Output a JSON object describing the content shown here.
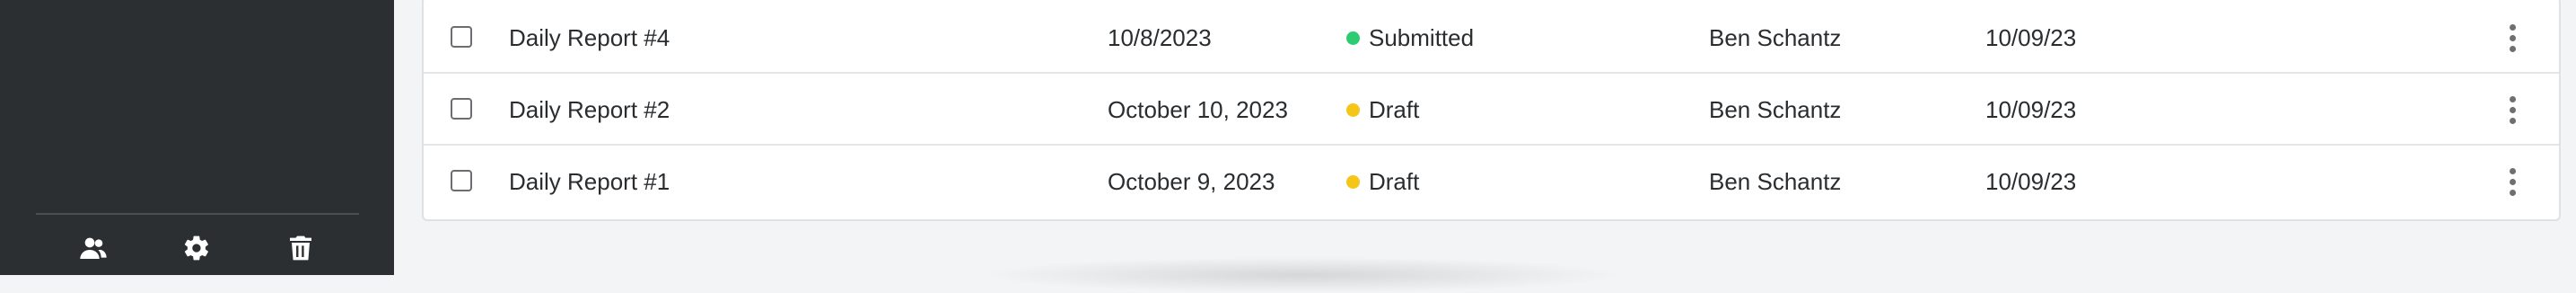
{
  "sidebar": {
    "footer_icons": [
      "users-icon",
      "gear-icon",
      "trash-icon"
    ]
  },
  "reports": {
    "rows": [
      {
        "title": "Daily Report #4",
        "report_date": "10/8/2023",
        "author": "Ben Schantz",
        "updated": "10/09/23",
        "status": "Submitted",
        "status_color": "#2ecc71"
      },
      {
        "title": "Daily Report #2",
        "report_date": "October 10, 2023",
        "author": "Ben Schantz",
        "updated": "10/09/23",
        "status": "Draft",
        "status_color": "#f5c518"
      },
      {
        "title": "Daily Report #1",
        "report_date": "October 9, 2023",
        "author": "Ben Schantz",
        "updated": "10/09/23",
        "status": "Draft",
        "status_color": "#f5c518"
      }
    ]
  }
}
